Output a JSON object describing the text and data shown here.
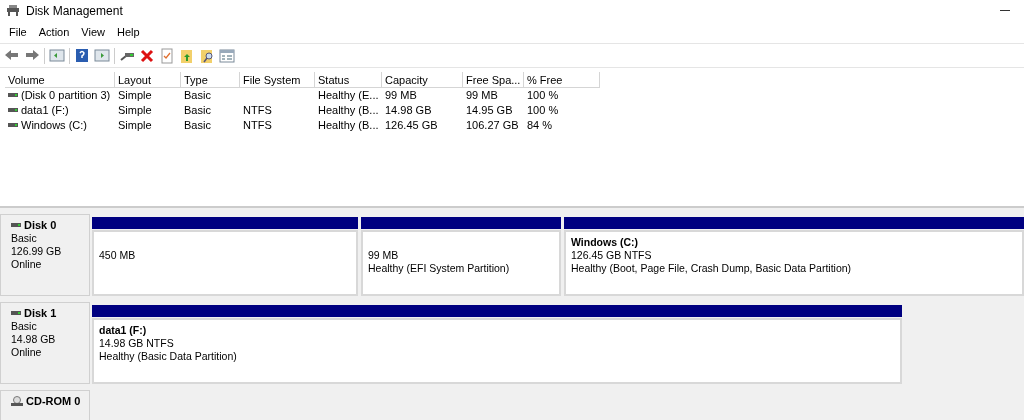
{
  "window": {
    "title": "Disk Management"
  },
  "menu": [
    "File",
    "Action",
    "View",
    "Help"
  ],
  "table": {
    "columns": [
      "Volume",
      "Layout",
      "Type",
      "File System",
      "Status",
      "Capacity",
      "Free Spa...",
      "% Free"
    ],
    "rows": [
      {
        "cells": [
          "(Disk 0 partition 3)",
          "Simple",
          "Basic",
          "",
          "Healthy (E...",
          "99 MB",
          "99 MB",
          "100 %"
        ]
      },
      {
        "cells": [
          "data1 (F:)",
          "Simple",
          "Basic",
          "NTFS",
          "Healthy (B...",
          "14.98 GB",
          "14.95 GB",
          "100 %"
        ]
      },
      {
        "cells": [
          "Windows (C:)",
          "Simple",
          "Basic",
          "NTFS",
          "Healthy (B...",
          "126.45 GB",
          "106.27 GB",
          "84 %"
        ]
      }
    ]
  },
  "disks": [
    {
      "kind": "disk",
      "name": "Disk 0",
      "type": "Basic",
      "size": "126.99 GB",
      "state": "Online",
      "partitions": [
        {
          "size": "450 MB"
        },
        {
          "size": "99 MB",
          "status": "Healthy (EFI System Partition)"
        },
        {
          "name": "Windows  (C:)",
          "size": "126.45 GB NTFS",
          "status": "Healthy (Boot, Page File, Crash Dump, Basic Data Partition)"
        }
      ]
    },
    {
      "kind": "disk",
      "name": "Disk 1",
      "type": "Basic",
      "size": "14.98 GB",
      "state": "Online",
      "partitions": [
        {
          "name": "data1  (F:)",
          "size": "14.98 GB NTFS",
          "status": "Healthy (Basic Data Partition)"
        }
      ]
    },
    {
      "kind": "cdrom",
      "name": "CD-ROM 0"
    }
  ]
}
